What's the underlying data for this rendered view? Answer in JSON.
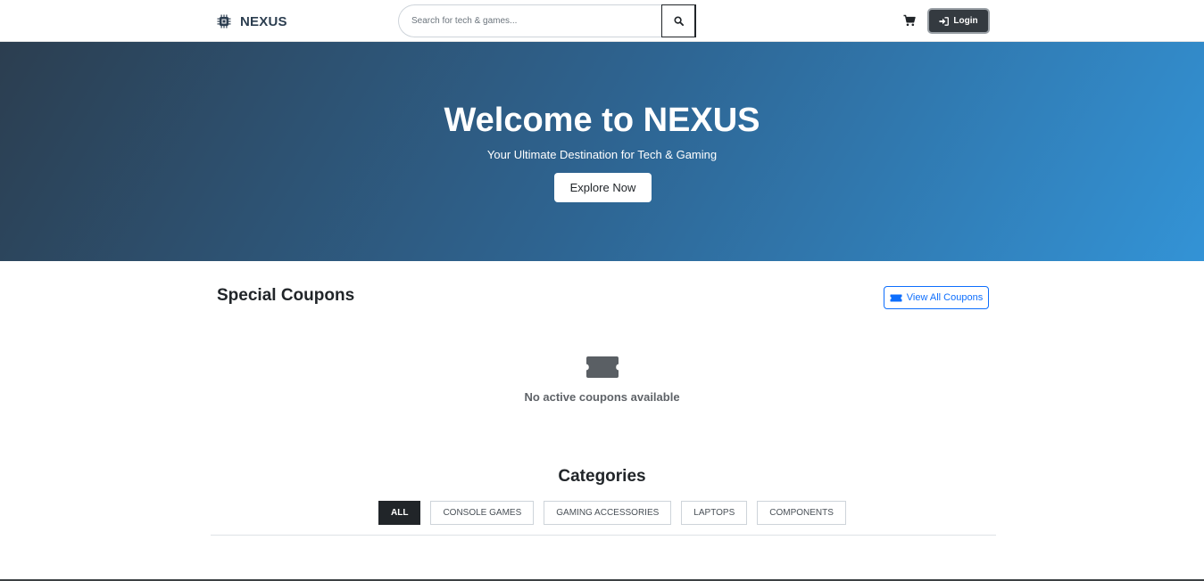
{
  "navbar": {
    "brand": "NEXUS",
    "brand_icon": "microchip-icon",
    "search_placeholder": "Search for tech & games...",
    "search_icon": "search-icon",
    "cart_icon": "cart-icon",
    "login_label": "Login",
    "login_icon": "sign-in-icon"
  },
  "hero": {
    "title": "Welcome to NEXUS",
    "subtitle": "Your Ultimate Destination for Tech & Gaming",
    "cta_label": "Explore Now",
    "gradient_start": "#2c3e50",
    "gradient_end": "#3393d6"
  },
  "coupons": {
    "title": "Special Coupons",
    "view_all_label": "View All Coupons",
    "view_all_icon": "ticket-icon",
    "empty_icon": "ticket-icon",
    "empty_message": "No active coupons available",
    "accent_color": "#0d6efd"
  },
  "categories": {
    "title": "Categories",
    "tabs": [
      {
        "label": "ALL",
        "active": true
      },
      {
        "label": "CONSOLE GAMES",
        "active": false
      },
      {
        "label": "GAMING ACCESSORIES",
        "active": false
      },
      {
        "label": "LAPTOPS",
        "active": false
      },
      {
        "label": "COMPONENTS",
        "active": false
      }
    ]
  }
}
